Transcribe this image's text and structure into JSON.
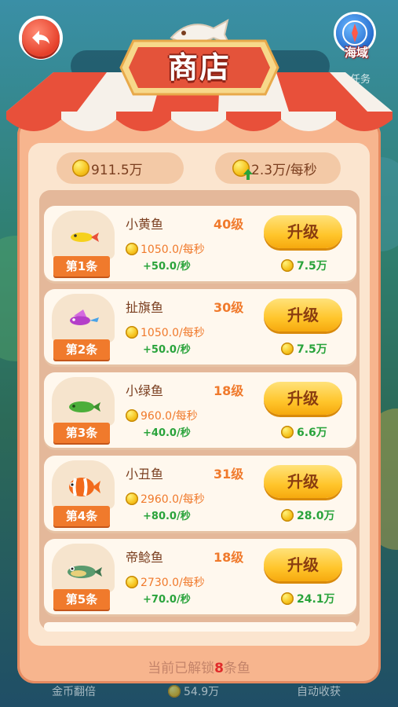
{
  "header": {
    "title": "商店",
    "sea_label": "海域",
    "task_label": "任务"
  },
  "stats": {
    "coins": "911.5万",
    "income": "2.3万/每秒"
  },
  "fish_list": [
    {
      "rank": "第1条",
      "name": "小黄鱼",
      "level": "40级",
      "rate": "1050.0/每秒",
      "bonus": "+50.0/秒",
      "button": "升级",
      "cost": "7.5万",
      "icon": "yellow-fish-icon"
    },
    {
      "rank": "第2条",
      "name": "扯旗鱼",
      "level": "30级",
      "rate": "1050.0/每秒",
      "bonus": "+50.0/秒",
      "button": "升级",
      "cost": "7.5万",
      "icon": "purple-fish-icon"
    },
    {
      "rank": "第3条",
      "name": "小绿鱼",
      "level": "18级",
      "rate": "960.0/每秒",
      "bonus": "+40.0/秒",
      "button": "升级",
      "cost": "6.6万",
      "icon": "green-fish-icon"
    },
    {
      "rank": "第4条",
      "name": "小丑鱼",
      "level": "31级",
      "rate": "2960.0/每秒",
      "bonus": "+80.0/秒",
      "button": "升级",
      "cost": "28.0万",
      "icon": "clownfish-icon"
    },
    {
      "rank": "第5条",
      "name": "帝鲶鱼",
      "level": "18级",
      "rate": "2730.0/每秒",
      "bonus": "+70.0/秒",
      "button": "升级",
      "cost": "24.1万",
      "icon": "catfish-icon"
    }
  ],
  "footer": {
    "prefix": "当前已解锁",
    "count": "8",
    "suffix": "条鱼"
  },
  "bottom_bar": {
    "left": "金币翻倍",
    "center": "54.9万",
    "right": "自动收获"
  },
  "colors": {
    "accent": "#f07a2c",
    "bonus_green": "#29a33b",
    "awning_red": "#e8503a",
    "button_yellow": "#ffc52b"
  }
}
